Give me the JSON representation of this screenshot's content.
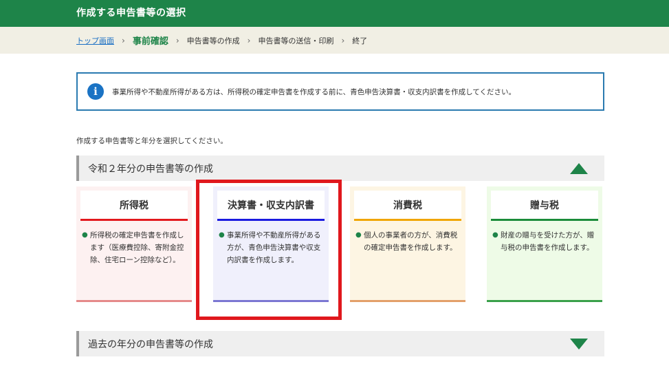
{
  "header": {
    "title": "作成する申告書等の選択"
  },
  "breadcrumb": {
    "home": "トップ画面",
    "current": "事前確認",
    "step3": "申告書等の作成",
    "step4": "申告書等の送信・印刷",
    "step5": "終了",
    "separator": "›"
  },
  "info": {
    "icon": "i",
    "message": "事業所得や不動産所得がある方は、所得税の確定申告書を作成する前に、青色申告決算書・収支内訳書を作成してください。"
  },
  "instruction": "作成する申告書等と年分を選択してください。",
  "current_year_section": {
    "label": "令和２年分の申告書等の作成",
    "toggle_icon": "triangle-up-icon"
  },
  "cards": [
    {
      "name": "所得税",
      "bullet": "●",
      "desc": "所得税の確定申告書を作成します（医療費控除、寄附金控除、住宅ローン控除など）。",
      "bg": "#fdf1f1",
      "accent": "#e2181d",
      "bottom": "#e58a8a"
    },
    {
      "name": "決算書・収支内訳書",
      "bullet": "●",
      "desc": "事業所得や不動産所得がある方が、青色申告決算書や収支内訳書を作成します。",
      "bg": "#f0f0fc",
      "accent": "#1a1ae0",
      "bottom": "#7b77d2",
      "highlighted": true
    },
    {
      "name": "消費税",
      "bullet": "●",
      "desc": "個人の事業者の方が、消費税の確定申告書を作成します。",
      "bg": "#fdf5e3",
      "accent": "#f0a500",
      "bottom": "#e3a06a"
    },
    {
      "name": "贈与税",
      "bullet": "●",
      "desc": "財産の贈与を受けた方が、贈与税の申告書を作成します。",
      "bg": "#eefbe7",
      "accent": "#1a8c3a",
      "bottom": "#3aa04a"
    }
  ],
  "past_year_section": {
    "label": "過去の年分の申告書等の作成",
    "toggle_icon": "triangle-down-icon"
  },
  "colors": {
    "header_green": "#1e8449",
    "highlight_red": "#e0181d",
    "link_blue": "#1a6fc4"
  }
}
